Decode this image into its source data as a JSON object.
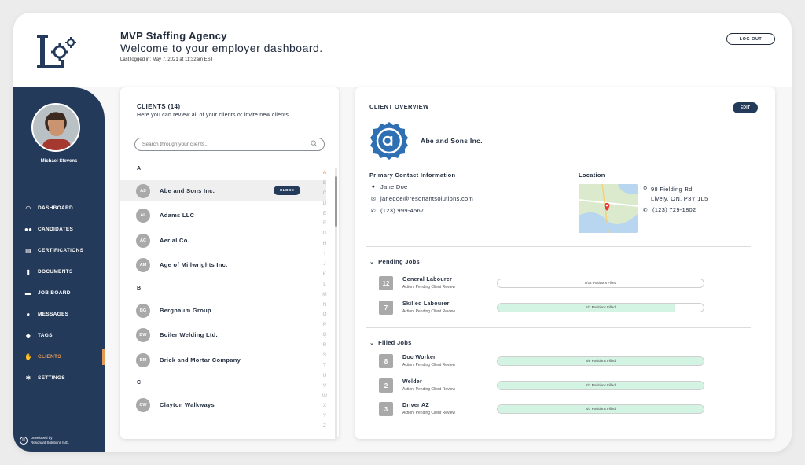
{
  "header": {
    "agency_name": "MVP Staffing Agency",
    "welcome": "Welcome to your employer dashboard.",
    "last_login": "Last logged in: May 7, 2021 at 11:32am EST",
    "logout_label": "LOG OUT"
  },
  "sidebar": {
    "user_name": "Michael Stevens",
    "items": [
      {
        "label": "DASHBOARD",
        "icon": "gauge-icon"
      },
      {
        "label": "CANDIDATES",
        "icon": "users-icon"
      },
      {
        "label": "CERTIFICATIONS",
        "icon": "certificate-icon"
      },
      {
        "label": "DOCUMENTS",
        "icon": "document-icon"
      },
      {
        "label": "JOB BOARD",
        "icon": "briefcase-icon"
      },
      {
        "label": "MESSAGES",
        "icon": "chat-icon"
      },
      {
        "label": "TAGS",
        "icon": "tag-icon"
      },
      {
        "label": "CLIENTS",
        "icon": "handshake-icon",
        "active": true
      },
      {
        "label": "SETTINGS",
        "icon": "gear-icon"
      }
    ],
    "dev_credit_line1": "Developed by",
    "dev_credit_line2": "Resonant Solutions INC.",
    "accent_color": "#e39a52",
    "bg_color": "#243a5a"
  },
  "clients": {
    "title": "CLIENTS (14)",
    "subtitle": "Here you can review all of your clients or invite new clients.",
    "search_placeholder": "Search through your clients...",
    "groups": [
      {
        "letter": "A",
        "items": [
          {
            "initials": "AS",
            "name": "Abe and Sons Inc.",
            "selected": true
          },
          {
            "initials": "AL",
            "name": "Adams LLC"
          },
          {
            "initials": "AC",
            "name": "Aerial Co."
          },
          {
            "initials": "AM",
            "name": "Age of Millwrights Inc."
          }
        ]
      },
      {
        "letter": "B",
        "items": [
          {
            "initials": "BG",
            "name": "Bergnaum Group"
          },
          {
            "initials": "BW",
            "name": "Boiler Welding Ltd."
          },
          {
            "initials": "BM",
            "name": "Brick and Mortar Company"
          }
        ]
      },
      {
        "letter": "C",
        "items": [
          {
            "initials": "CW",
            "name": "Clayton Walkways"
          }
        ]
      }
    ],
    "close_label": "CLOSE",
    "alphabet": [
      "A",
      "B",
      "C",
      "D",
      "E",
      "F",
      "G",
      "H",
      "I",
      "J",
      "K",
      "L",
      "M",
      "N",
      "O",
      "P",
      "Q",
      "R",
      "S",
      "T",
      "U",
      "V",
      "W",
      "X",
      "Y",
      "Z"
    ],
    "alphabet_active": "A"
  },
  "overview": {
    "title": "CLIENT OVERVIEW",
    "edit_label": "EDIT",
    "company_name": "Abe and Sons Inc.",
    "contact_heading": "Primary Contact Information",
    "contact_name": "Jane Doe",
    "contact_email": "janedoe@resonantsolutions.com",
    "contact_phone": "(123) 999-4567",
    "location_heading": "Location",
    "address_line1": "98 Fielding Rd,",
    "address_line2": "Lively, ON, P3Y 1L5",
    "location_phone": "(123) 729-1802",
    "pending_heading": "Pending Jobs",
    "filled_heading": "Filled Jobs",
    "pending_jobs": [
      {
        "count": "12",
        "name": "General Labourer",
        "action": "Action: Pending Client Review",
        "progress": 0.0,
        "progress_label": "0/12 Positions Filled"
      },
      {
        "count": "7",
        "name": "Skilled Labourer",
        "action": "Action: Pending Client Review",
        "progress": 0.8571,
        "progress_label": "6/7 Positions Filled"
      }
    ],
    "filled_jobs": [
      {
        "count": "8",
        "name": "Doc Worker",
        "action": "Action: Pending Client Review",
        "progress": 1.0,
        "progress_label": "8/8 Positions Filled"
      },
      {
        "count": "2",
        "name": "Welder",
        "action": "Action: Pending Client Review",
        "progress": 1.0,
        "progress_label": "2/2 Positions Filled"
      },
      {
        "count": "3",
        "name": "Driver AZ",
        "action": "Action: Pending Client Review",
        "progress": 1.0,
        "progress_label": "3/3 Positions Filled"
      }
    ],
    "brand_color": "#2f6fb3"
  }
}
